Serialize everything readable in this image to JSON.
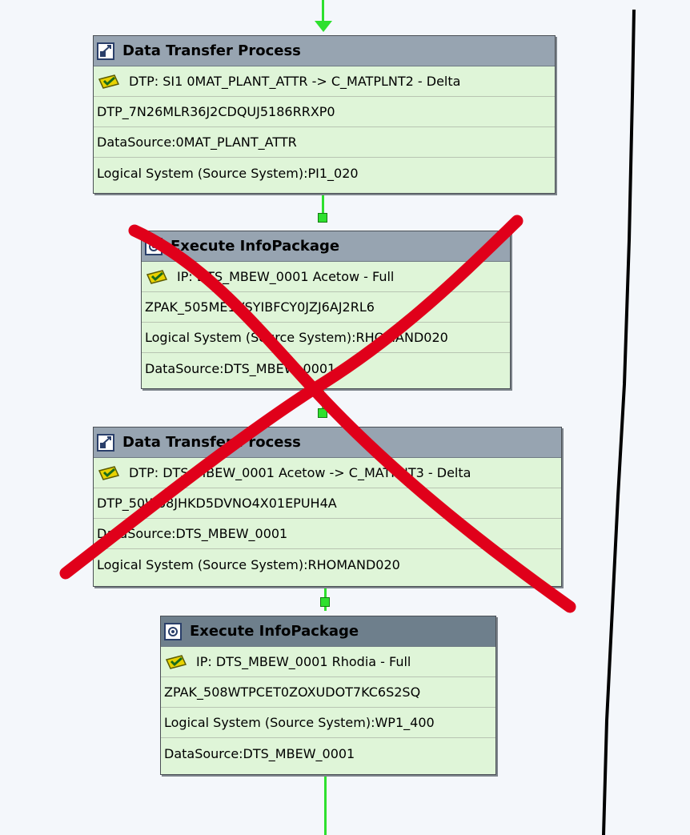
{
  "nodes": [
    {
      "title": "Data Transfer Process",
      "icon": "dtp-icon",
      "rows": [
        "DTP: SI1 0MAT_PLANT_ATTR -> C_MATPLNT2 - Delta",
        "DTP_7N26MLR36J2CDQUJ5186RRXP0",
        "DataSource:0MAT_PLANT_ATTR",
        "Logical System (Source System):PI1_020"
      ]
    },
    {
      "title": "Execute InfoPackage",
      "icon": "infopackage-icon",
      "rows": [
        "IP: DTS_MBEW_0001 Acetow - Full",
        "ZPAK_505ME1VSYIBFCY0JZJ6AJ2RL6",
        "Logical System (Source System):RHOMAND020",
        "DataSource:DTS_MBEW_0001"
      ]
    },
    {
      "title": "Data Transfer Process",
      "icon": "dtp-icon",
      "rows": [
        "DTP: DTS_MBEW_0001 Acetow -> C_MATPNT3 - Delta",
        "DTP_50W68JHKD5DVNO4X01EPUH4A",
        "DataSource:DTS_MBEW_0001",
        "Logical System (Source System):RHOMAND020"
      ]
    },
    {
      "title": "Execute InfoPackage",
      "icon": "infopackage-icon",
      "rows": [
        "IP: DTS_MBEW_0001 Rhodia - Full",
        "ZPAK_508WTPCET0ZOXUDOT7KC6S2SQ",
        "Logical System (Source System):WP1_400",
        "DataSource:DTS_MBEW_0001"
      ]
    }
  ],
  "colors": {
    "connector": "#2ee02e",
    "strike": "#e0001a",
    "node_bg": "#dff5d8"
  }
}
